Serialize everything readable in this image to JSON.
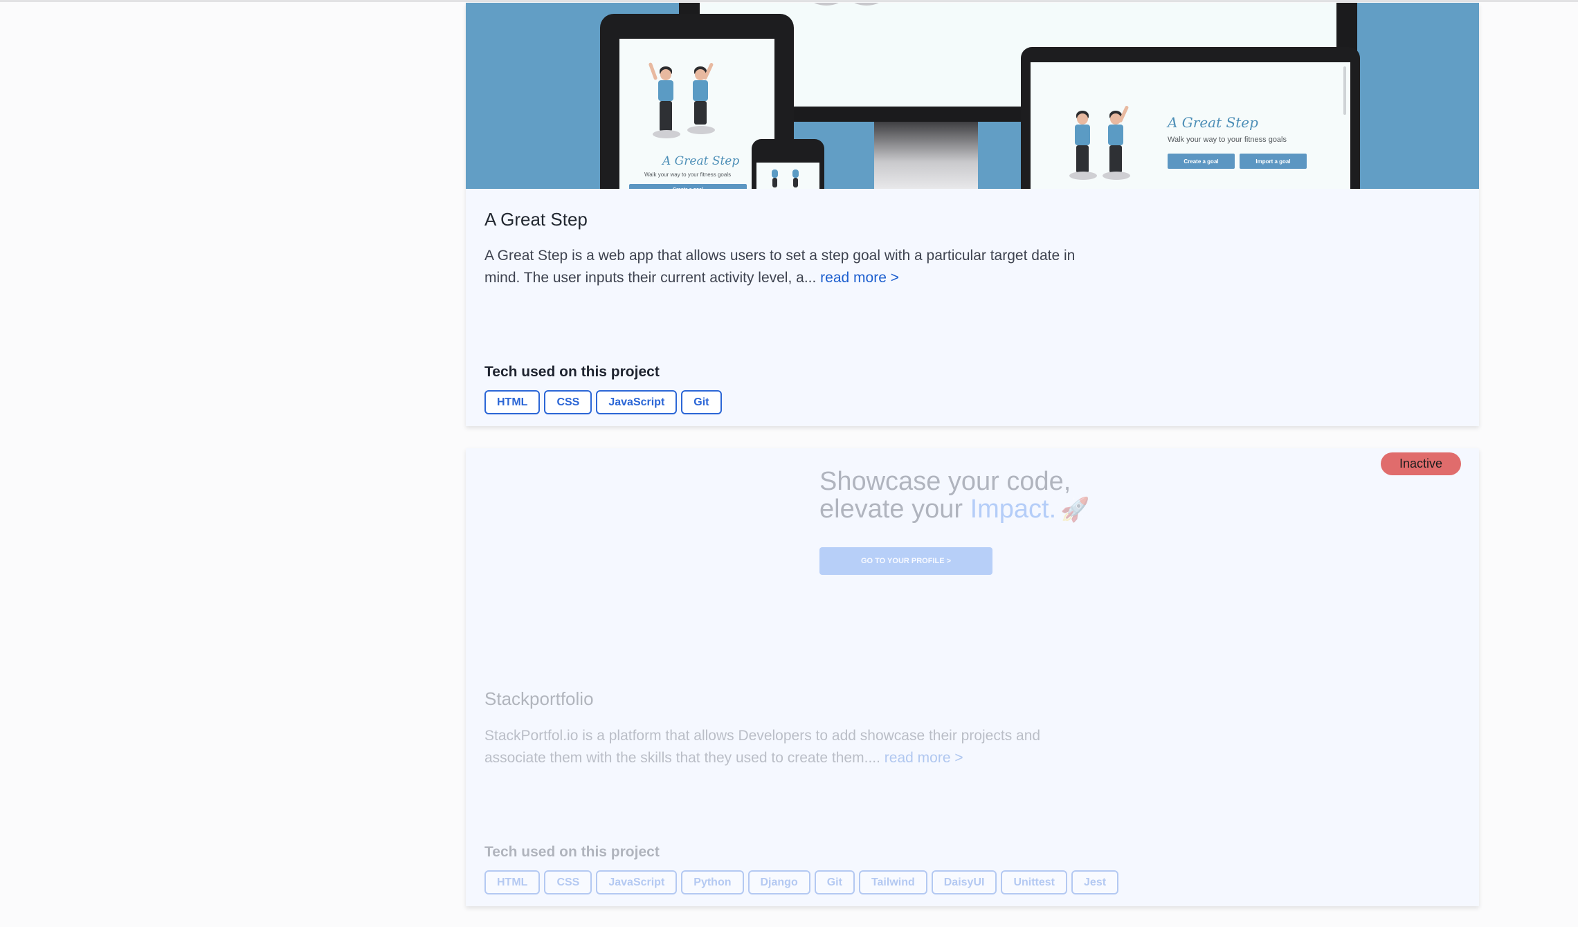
{
  "projects": [
    {
      "title": "A Great Step",
      "description": "A Great Step is a web app that allows users to set a step goal with a particular target date in mind. The user inputs their current activity level, a...",
      "read_more": "read more >",
      "tech_heading": "Tech used on this project",
      "tags": [
        "HTML",
        "CSS",
        "JavaScript",
        "Git"
      ],
      "hero": {
        "app_title": "A Great Step",
        "app_subtitle": "Walk your way to your fitness goals",
        "btn_create": "Create a goal",
        "btn_import": "Import a goal",
        "bg_color": "#629ec5"
      }
    },
    {
      "status_badge": "Inactive",
      "title": "Stackportfolio",
      "description": "StackPortfol.io is a platform that allows Developers to add showcase their projects and associate them with the skills that they used to create them....",
      "read_more": "read more >",
      "tech_heading": "Tech used on this project",
      "tags": [
        "HTML",
        "CSS",
        "JavaScript",
        "Python",
        "Django",
        "Git",
        "Tailwind",
        "DaisyUI",
        "Unittest",
        "Jest"
      ],
      "hero": {
        "headline_line1": "Showcase your code,",
        "headline_line2_prefix": "elevate your ",
        "headline_accent": "Impact.",
        "cta": "GO TO YOUR PROFILE >"
      }
    }
  ],
  "colors": {
    "tag_border": "#2b66d6",
    "link": "#1d5fcf",
    "inactive_badge": "#e06c6c",
    "card_bg": "#f5f8ff"
  }
}
